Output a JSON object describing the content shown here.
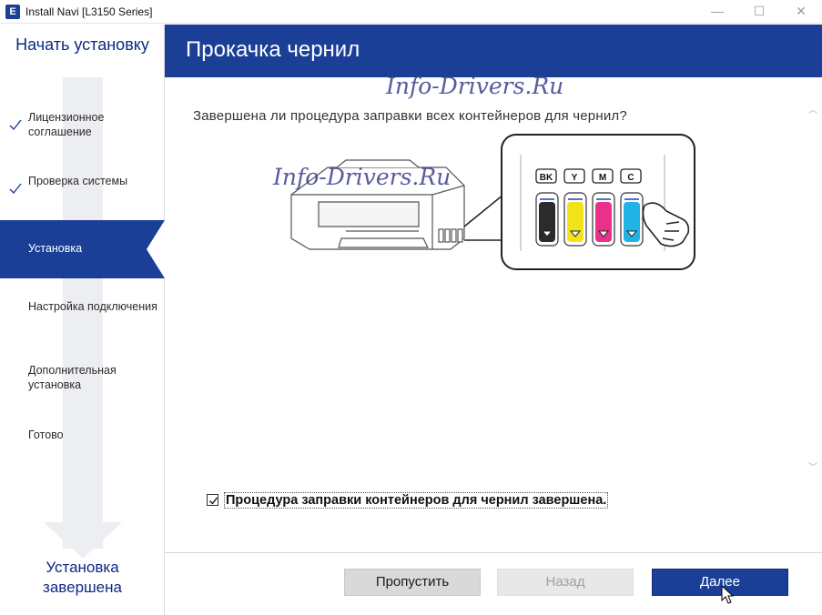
{
  "window": {
    "title": "Install Navi [L3150 Series]",
    "app_icon_letter": "E",
    "minimize": "—",
    "maximize": "☐",
    "close": "✕"
  },
  "sidebar": {
    "title": "Начать установку",
    "items": [
      {
        "label": "Лицензионное соглашение",
        "state": "done"
      },
      {
        "label": "Проверка системы",
        "state": "done"
      },
      {
        "label": "Установка",
        "state": "active"
      },
      {
        "label": "Настройка подключения",
        "state": "pending"
      },
      {
        "label": "Дополнительная установка",
        "state": "pending"
      },
      {
        "label": "Готово",
        "state": "pending"
      }
    ],
    "footer_line1": "Установка",
    "footer_line2": "завершена"
  },
  "header": {
    "title": "Прокачка чернил"
  },
  "content": {
    "watermark": "Info-Drivers.Ru",
    "question": "Завершена ли процедура заправки всех контейнеров для чернил?",
    "ink_labels": [
      "BK",
      "Y",
      "M",
      "C"
    ],
    "ink_colors": [
      "#2b2b2b",
      "#f2e21a",
      "#e8328a",
      "#1fb3e6"
    ],
    "confirm_label": "Процедура заправки контейнеров для чернил завершена.",
    "confirm_checked": true
  },
  "footer": {
    "skip_label": "Пропустить",
    "back_label": "Назад",
    "next_label": "Далее"
  },
  "colors": {
    "accent": "#1b3f97",
    "sidebar_text": "#0d2a84"
  }
}
